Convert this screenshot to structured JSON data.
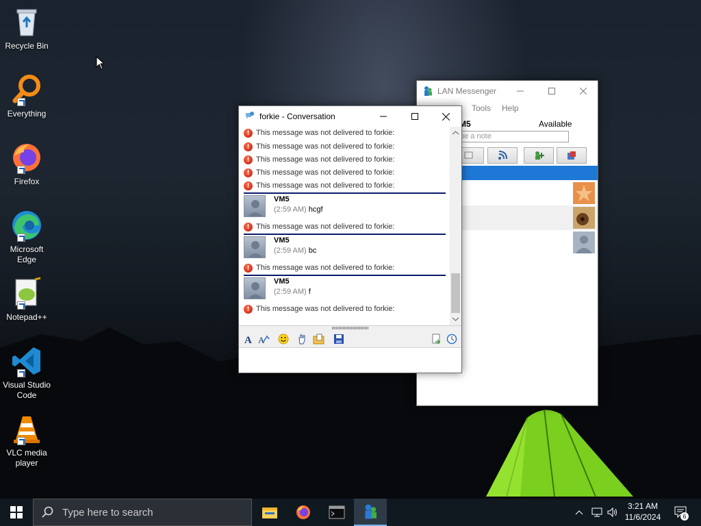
{
  "desktop": {
    "icons": [
      {
        "label": "Recycle Bin"
      },
      {
        "label": "Everything"
      },
      {
        "label": "Firefox"
      },
      {
        "label": "Microsoft Edge"
      },
      {
        "label": "Notepad++"
      },
      {
        "label": "Visual Studio Code"
      },
      {
        "label": "VLC media player"
      }
    ]
  },
  "lan_messenger": {
    "title": "LAN Messenger",
    "menu": {
      "partial_label": "",
      "tools": "Tools",
      "help": "Help"
    },
    "user_name_partial": "M5",
    "status": "Available",
    "note_placeholder_partial": "pe a note"
  },
  "conversation": {
    "title": "forkie - Conversation",
    "error_text": "This message was not delivered to forkie:",
    "messages": [
      {
        "sender": "VM5",
        "time": "(2:59 AM)",
        "text": "hcgf"
      },
      {
        "sender": "VM5",
        "time": "(2:59 AM)",
        "text": "bc"
      },
      {
        "sender": "VM5",
        "time": "(2:59 AM)",
        "text": "f"
      }
    ]
  },
  "taskbar": {
    "search_placeholder": "Type here to search",
    "time": "3:21 AM",
    "date": "11/6/2024",
    "notification_count": "6"
  },
  "colors": {
    "accent": "#1e78d6",
    "error_red": "#c21807",
    "separator": "#0a1a6b",
    "taskbar": "#101820"
  }
}
